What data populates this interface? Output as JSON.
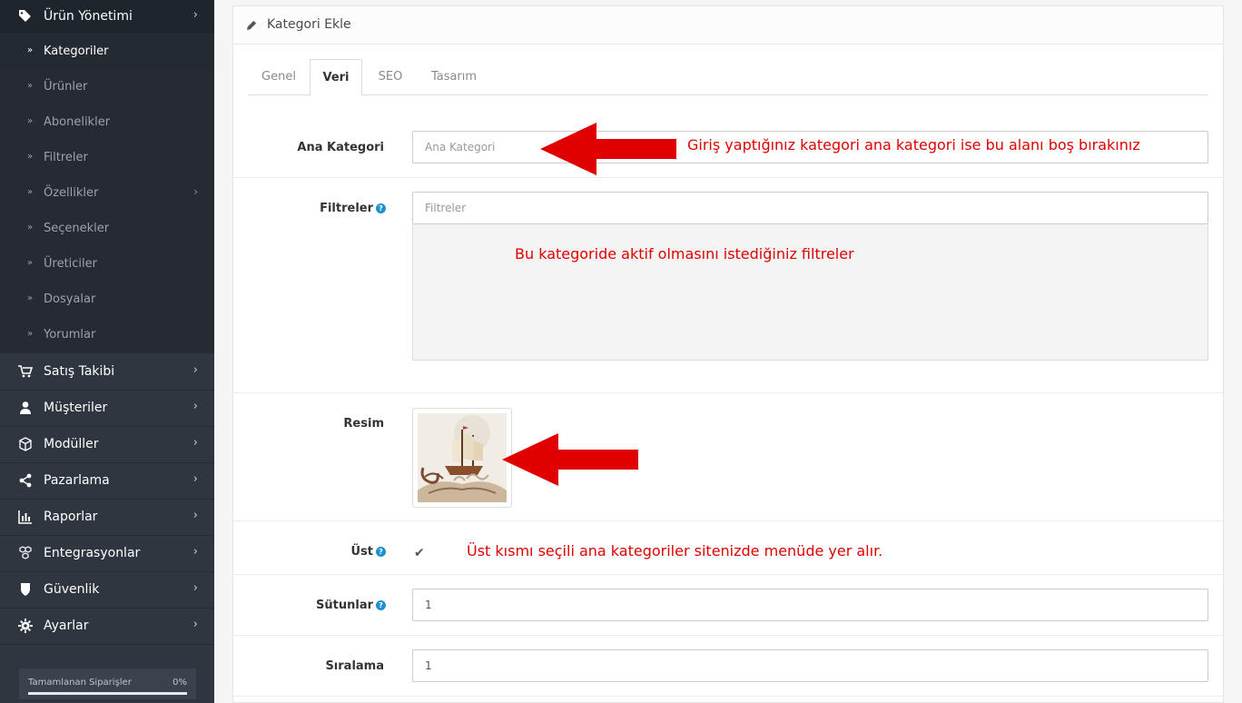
{
  "sidebar": {
    "top_item": {
      "label": "Ürün Yönetimi",
      "icon": "tags-icon"
    },
    "sub_items": [
      {
        "label": "Kategoriler",
        "active": true
      },
      {
        "label": "Ürünler"
      },
      {
        "label": "Abonelikler"
      },
      {
        "label": "Filtreler"
      },
      {
        "label": "Özellikler",
        "has_children": true
      },
      {
        "label": "Seçenekler"
      },
      {
        "label": "Üreticiler"
      },
      {
        "label": "Dosyalar"
      },
      {
        "label": "Yorumlar"
      }
    ],
    "items": [
      {
        "label": "Satış Takibi",
        "icon": "cart-icon"
      },
      {
        "label": "Müşteriler",
        "icon": "user-icon"
      },
      {
        "label": "Modüller",
        "icon": "cube-icon"
      },
      {
        "label": "Pazarlama",
        "icon": "share-icon"
      },
      {
        "label": "Raporlar",
        "icon": "bar-chart-icon"
      },
      {
        "label": "Entegrasyonlar",
        "icon": "cubes-icon"
      },
      {
        "label": "Güvenlik",
        "icon": "shield-icon"
      },
      {
        "label": "Ayarlar",
        "icon": "gear-icon"
      }
    ],
    "progress": {
      "label": "Tamamlanan Siparişler",
      "value": "0%",
      "fraction": 0
    }
  },
  "panel": {
    "title": "Kategori Ekle",
    "icon": "pencil-icon",
    "tabs": [
      {
        "label": "Genel"
      },
      {
        "label": "Veri",
        "active": true
      },
      {
        "label": "SEO"
      },
      {
        "label": "Tasarım"
      }
    ]
  },
  "form": {
    "parent": {
      "label": "Ana Kategori",
      "placeholder": "Ana Kategori"
    },
    "filters": {
      "label": "Filtreler",
      "placeholder": "Filtreler"
    },
    "image": {
      "label": "Resim"
    },
    "top": {
      "label": "Üst",
      "checked": true
    },
    "columns": {
      "label": "Sütunlar",
      "value": "1"
    },
    "sort": {
      "label": "Sıralama",
      "value": "1"
    }
  },
  "annotations": {
    "parent_note": "Giriş yaptığınız kategori ana kategori ise bu alanı boş bırakınız",
    "filters_note": "Bu kategoride aktif olmasını istediğiniz filtreler",
    "top_note": "Üst kısmı seçili ana kategoriler sitenizde menüde yer alır.",
    "color": "#e00000"
  }
}
